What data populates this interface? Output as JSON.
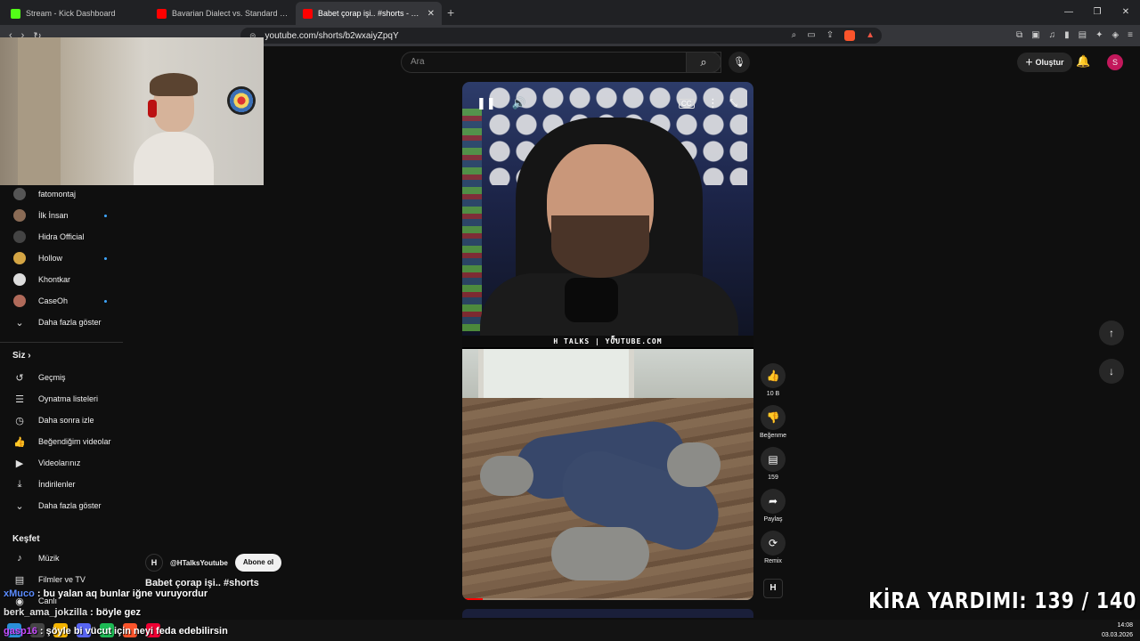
{
  "browser": {
    "tabs": [
      {
        "title": "Stream - Kick Dashboard",
        "color": "#53fc18",
        "active": false
      },
      {
        "title": "Bavarian Dialect vs. Standard German",
        "color": "#ff0000",
        "active": false
      },
      {
        "title": "Babet çorap işi.. #shorts - YouTube",
        "color": "#ff0000",
        "active": true
      }
    ],
    "url": "youtube.com/shorts/b2wxaiyZpqY"
  },
  "header": {
    "search_placeholder": "Ara",
    "create_label": "Oluştur",
    "avatar_letter": "S"
  },
  "sidebar": {
    "subscriptions": [
      {
        "label": "fatomontaj",
        "new": false,
        "color": "#555"
      },
      {
        "label": "İlk İnsan",
        "new": true,
        "color": "#8a6b55"
      },
      {
        "label": "Hidra Official",
        "new": false,
        "color": "#444"
      },
      {
        "label": "Hollow",
        "new": true,
        "color": "#d4a544"
      },
      {
        "label": "Khontkar",
        "new": false,
        "color": "#ddd"
      },
      {
        "label": "CaseOh",
        "new": true,
        "color": "#b06a5a"
      }
    ],
    "show_more_1": "Daha fazla göster",
    "you_heading": "Siz",
    "you_items": [
      {
        "label": "Geçmiş",
        "icon": "history-icon",
        "glyph": "↺"
      },
      {
        "label": "Oynatma listeleri",
        "icon": "playlist-icon",
        "glyph": "☰"
      },
      {
        "label": "Daha sonra izle",
        "icon": "clock-icon",
        "glyph": "◷"
      },
      {
        "label": "Beğendiğim videolar",
        "icon": "thumbs-up-icon",
        "glyph": "👍"
      },
      {
        "label": "Videolarınız",
        "icon": "video-icon",
        "glyph": "▶"
      },
      {
        "label": "İndirilenler",
        "icon": "download-icon",
        "glyph": "⤓"
      }
    ],
    "show_more_2": "Daha fazla göster",
    "explore_heading": "Keşfet",
    "explore_items": [
      {
        "label": "Müzik",
        "icon": "music-icon",
        "glyph": "♪"
      },
      {
        "label": "Filmler ve TV",
        "icon": "film-icon",
        "glyph": "▤"
      },
      {
        "label": "Canlı",
        "icon": "live-icon",
        "glyph": "◉"
      }
    ]
  },
  "short": {
    "caption": "H TALKS | YOUTUBE.COM",
    "channel": "@HTalksYoutube",
    "channel_initial": "H",
    "subscribe_label": "Abone ol",
    "title": "Babet çorap işi.. #shorts",
    "progress": 0.07
  },
  "actions": {
    "likes": "10 B",
    "dislike_label": "Beğenme",
    "comments": "159",
    "share_label": "Paylaş",
    "remix_label": "Remix"
  },
  "stream_overlay": {
    "chat": [
      {
        "user": "xMuco",
        "text": ": bu yalan aq bunlar iğne vuruyordur",
        "color": "#5b8cff"
      },
      {
        "user": "berk_ama_jokzilla",
        "text": ": böyle gez",
        "color": "#e0e0e0"
      },
      {
        "user": "gasp16",
        "text": ": şöyle bi vücut için neyi feda edebilirsin",
        "color": "#c84bff"
      }
    ],
    "rent_label": "KİRA YARDIMI:",
    "rent_value": "139 / 140"
  },
  "taskbar": {
    "time": "14:08",
    "date": "03.03.2026"
  }
}
